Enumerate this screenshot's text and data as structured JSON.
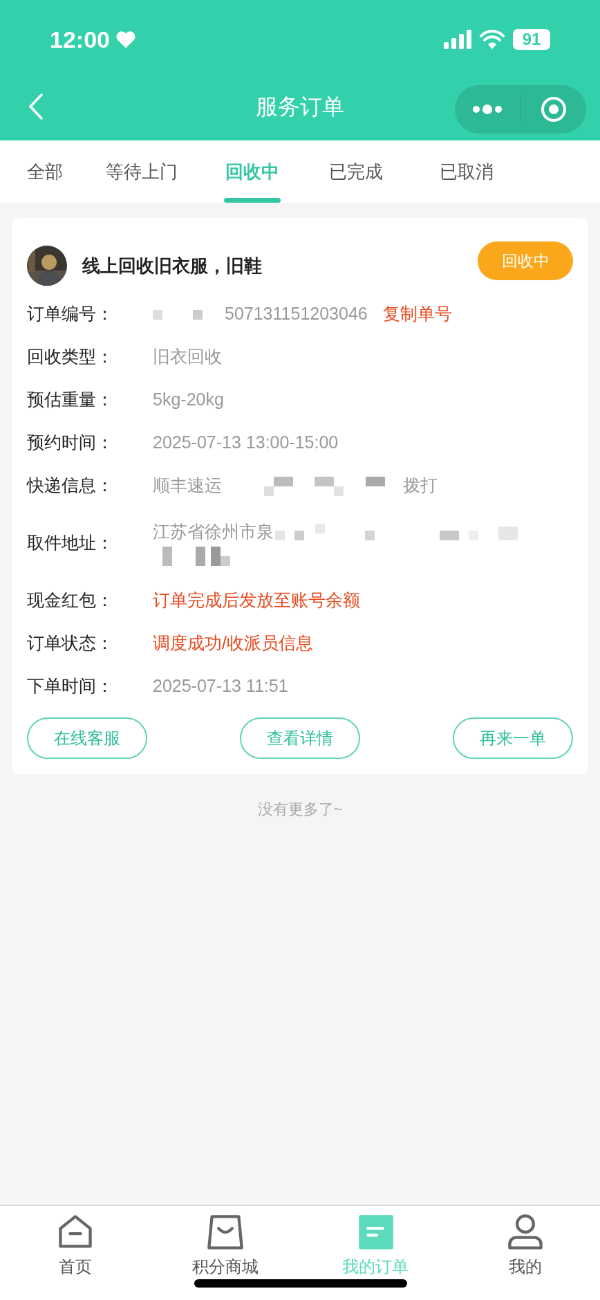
{
  "status_bar": {
    "time": "12:00",
    "battery": "91"
  },
  "nav_bar": {
    "title": "服务订单"
  },
  "tabs": [
    {
      "label": "全部",
      "selected": false
    },
    {
      "label": "等待上门",
      "selected": false
    },
    {
      "label": "回收中",
      "selected": true
    },
    {
      "label": "已完成",
      "selected": false
    },
    {
      "label": "已取消",
      "selected": false
    }
  ],
  "order": {
    "title": "线上回收旧衣服，旧鞋",
    "status_badge": "回收中",
    "fields": [
      {
        "label": "订单编号：",
        "value": "507131151203046",
        "action": "复制单号",
        "kind": "redacted_prefix"
      },
      {
        "label": "回收类型：",
        "value": "旧衣回收",
        "kind": "plain"
      },
      {
        "label": "预估重量：",
        "value": "5kg-20kg",
        "kind": "plain"
      },
      {
        "label": "预约时间：",
        "value": "2025-07-13 13:00-15:00",
        "kind": "plain"
      },
      {
        "label": "快递信息：",
        "value": "顺丰速运",
        "action": "拨打",
        "kind": "redacted_middle"
      },
      {
        "label": "取件地址：",
        "value": "江苏省徐州市泉",
        "kind": "redacted_address"
      },
      {
        "label": "现金红包：",
        "value": "订单完成后发放至账号余额",
        "kind": "highlight"
      },
      {
        "label": "订单状态：",
        "value": "调度成功/收派员信息",
        "kind": "highlight"
      },
      {
        "label": "下单时间：",
        "value": "2025-07-13 11:51",
        "kind": "plain"
      }
    ],
    "buttons": [
      "在线客服",
      "查看详情",
      "再来一单"
    ]
  },
  "footer_note": "没有更多了~",
  "bottom_nav": [
    {
      "label": "首页",
      "selected": false,
      "kind": "home"
    },
    {
      "label": "积分商城",
      "selected": false,
      "kind": "bag"
    },
    {
      "label": "我的订单",
      "selected": true,
      "kind": "orders"
    },
    {
      "label": "我的",
      "selected": false,
      "kind": "person"
    }
  ]
}
